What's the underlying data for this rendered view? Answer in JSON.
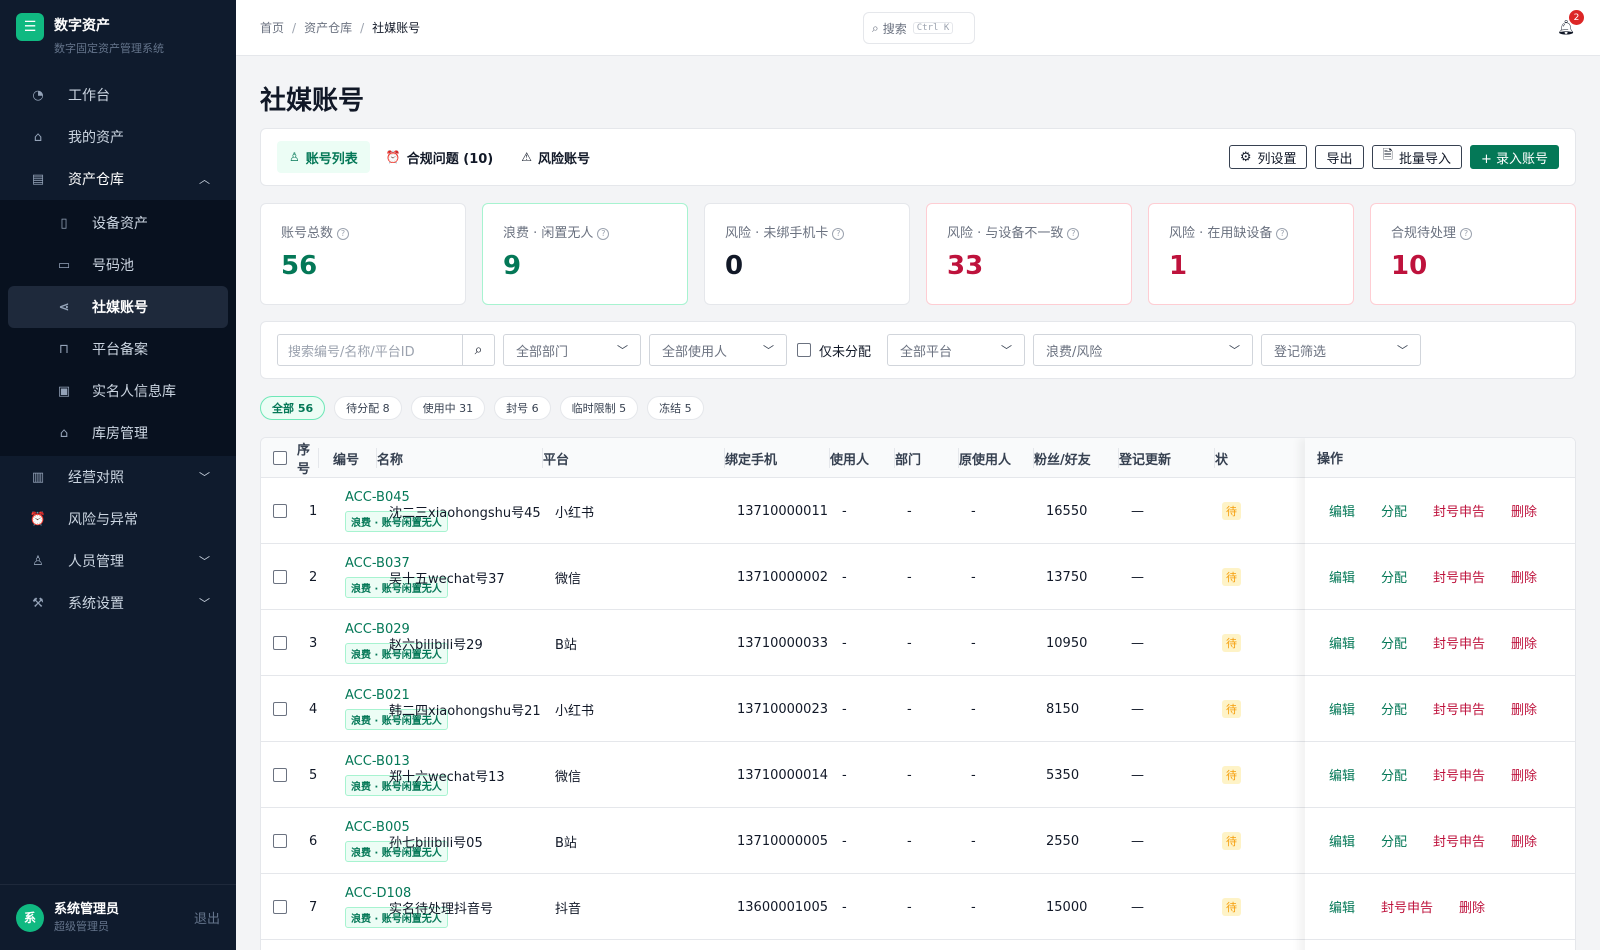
{
  "app": {
    "title": "数字资产",
    "subtitle": "数字固定资产管理系统",
    "logo": "☰"
  },
  "nav": {
    "items": [
      {
        "label": "工作台",
        "icon": "dashboard-icon"
      },
      {
        "label": "我的资产",
        "icon": "lock-icon"
      },
      {
        "label": "资产仓库",
        "icon": "archive-icon"
      }
    ],
    "sub_items": [
      {
        "label": "设备资产"
      },
      {
        "label": "号码池"
      },
      {
        "label": "社媒账号"
      },
      {
        "label": "平台备案"
      },
      {
        "label": "实名人信息库"
      },
      {
        "label": "库房管理"
      }
    ],
    "bottom_items": [
      {
        "label": "经营对照"
      },
      {
        "label": "风险与异常"
      },
      {
        "label": "人员管理"
      },
      {
        "label": "系统设置"
      }
    ]
  },
  "user": {
    "avatar": "系",
    "name": "系统管理员",
    "role": "超级管理员",
    "logout": "退出"
  },
  "breadcrumb": [
    "首页",
    "资产仓库",
    "社媒账号"
  ],
  "search": {
    "label": "搜索",
    "shortcut": "Ctrl K"
  },
  "notifications": {
    "count": "2"
  },
  "page_title": "社媒账号",
  "tabs": [
    "账号列表",
    "合规问题 (10)",
    "风险账号"
  ],
  "toolbar": {
    "columns": "列设置",
    "export": "导出",
    "import": "批量导入",
    "add": "+ 录入账号"
  },
  "stats": [
    {
      "label": "账号总数",
      "value": "56",
      "color": "#047857"
    },
    {
      "label": "浪费 · 闲置无人",
      "value": "9",
      "color": "#047857"
    },
    {
      "label": "风险 · 未绑手机卡",
      "value": "0",
      "color": "#111827"
    },
    {
      "label": "风险 · 与设备不一致",
      "value": "33",
      "color": "#be123c"
    },
    {
      "label": "风险 · 在用缺设备",
      "value": "1",
      "color": "#be123c"
    },
    {
      "label": "合规待处理",
      "value": "10",
      "color": "#be123c"
    }
  ],
  "filters": {
    "search_placeholder": "搜索编号/名称/平台ID",
    "dept": "全部部门",
    "user": "全部使用人",
    "unassigned": "仅未分配",
    "platform": "全部平台",
    "waste": "浪费/风险",
    "register": "登记筛选"
  },
  "status_pills": [
    "全部 56",
    "待分配 8",
    "使用中 31",
    "封号 6",
    "临时限制 5",
    "冻结 5"
  ],
  "table": {
    "headers": [
      "序号",
      "编号",
      "名称",
      "平台",
      "绑定手机",
      "使用人",
      "部门",
      "原使用人",
      "粉丝/好友",
      "登记更新",
      "状",
      "操作"
    ],
    "tag": "浪费 · 账号闲置无人",
    "status_snippet": "待",
    "rows": [
      {
        "no": "1",
        "code": "ACC-B045",
        "name": "沈二三xiaohongshu号45",
        "platform": "小红书",
        "phone": "13710000011",
        "user": "-",
        "dept": "-",
        "prev": "-",
        "fans": "16550",
        "updated": "—",
        "ops": [
          "编辑",
          "分配",
          "封号申告",
          "删除"
        ]
      },
      {
        "no": "2",
        "code": "ACC-B037",
        "name": "吴十五wechat号37",
        "platform": "微信",
        "phone": "13710000002",
        "user": "-",
        "dept": "-",
        "prev": "-",
        "fans": "13750",
        "updated": "—",
        "ops": [
          "编辑",
          "分配",
          "封号申告",
          "删除"
        ]
      },
      {
        "no": "3",
        "code": "ACC-B029",
        "name": "赵六bilibili号29",
        "platform": "B站",
        "phone": "13710000033",
        "user": "-",
        "dept": "-",
        "prev": "-",
        "fans": "10950",
        "updated": "—",
        "ops": [
          "编辑",
          "分配",
          "封号申告",
          "删除"
        ]
      },
      {
        "no": "4",
        "code": "ACC-B021",
        "name": "韩二四xiaohongshu号21",
        "platform": "小红书",
        "phone": "13710000023",
        "user": "-",
        "dept": "-",
        "prev": "-",
        "fans": "8150",
        "updated": "—",
        "ops": [
          "编辑",
          "分配",
          "封号申告",
          "删除"
        ]
      },
      {
        "no": "5",
        "code": "ACC-B013",
        "name": "郑十六wechat号13",
        "platform": "微信",
        "phone": "13710000014",
        "user": "-",
        "dept": "-",
        "prev": "-",
        "fans": "5350",
        "updated": "—",
        "ops": [
          "编辑",
          "分配",
          "封号申告",
          "删除"
        ]
      },
      {
        "no": "6",
        "code": "ACC-B005",
        "name": "孙七bilibili号05",
        "platform": "B站",
        "phone": "13710000005",
        "user": "-",
        "dept": "-",
        "prev": "-",
        "fans": "2550",
        "updated": "—",
        "ops": [
          "编辑",
          "分配",
          "封号申告",
          "删除"
        ]
      },
      {
        "no": "7",
        "code": "ACC-D108",
        "name": "实名待处理抖音号",
        "platform": "抖音",
        "phone": "13600001005",
        "user": "-",
        "dept": "-",
        "prev": "-",
        "fans": "15000",
        "updated": "—",
        "ops": [
          "编辑",
          "封号申告",
          "删除"
        ]
      }
    ]
  }
}
